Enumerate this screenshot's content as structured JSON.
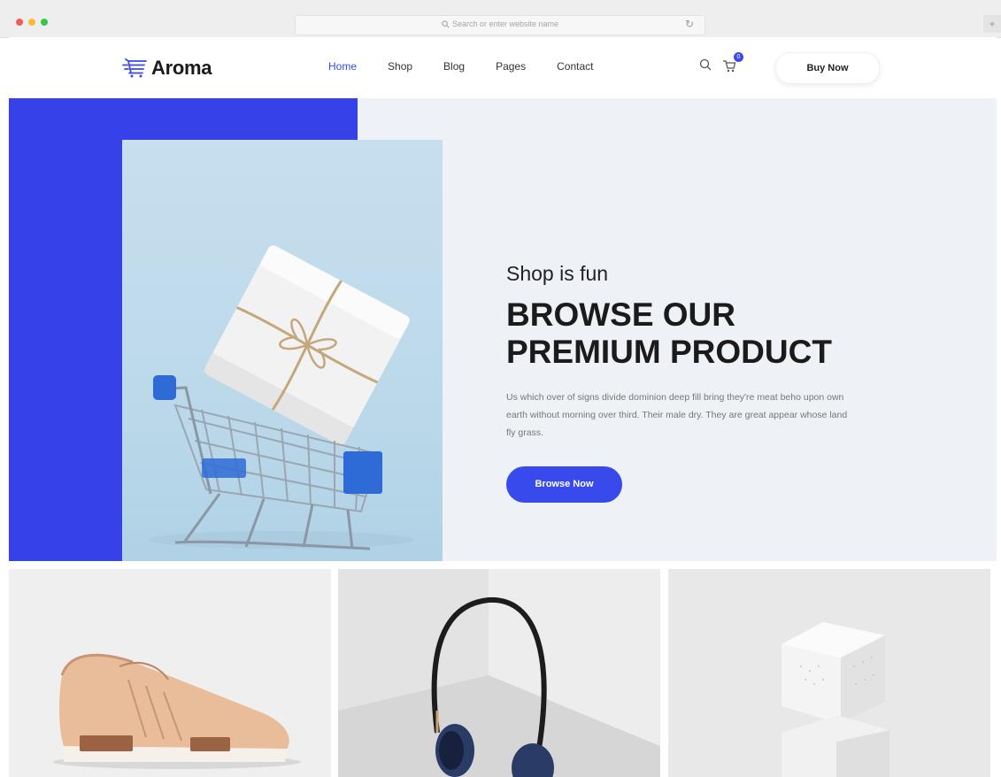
{
  "browser": {
    "address_placeholder": "Search or enter website name",
    "colors": {
      "close": "#f25e57",
      "minimize": "#f8bd2e",
      "maximize": "#33c649"
    },
    "icons": [
      "search-icon",
      "reload-icon",
      "new-tab-icon"
    ]
  },
  "header": {
    "logo_text": "Aroma",
    "logo_icon": "shopping-cart-icon",
    "nav": [
      {
        "label": "Home",
        "active": true
      },
      {
        "label": "Shop",
        "active": false
      },
      {
        "label": "Blog",
        "active": false
      },
      {
        "label": "Pages",
        "active": false
      },
      {
        "label": "Contact",
        "active": false
      }
    ],
    "cart_count": "0",
    "buy_now_label": "Buy Now",
    "icons": [
      "search-icon",
      "cart-icon"
    ]
  },
  "hero": {
    "subtitle": "Shop is fun",
    "title_line1": "BROWSE OUR",
    "title_line2": "PREMIUM PRODUCT",
    "description": "Us which over of signs divide dominion deep fill bring they're meat beho upon own earth without morning over third. Their male dry. They are great appear whose land fly grass.",
    "button_label": "Browse Now",
    "accent_color": "#384aeb",
    "image": "shopping-cart-with-gift-box"
  },
  "products": [
    {
      "image": "sneaker-image"
    },
    {
      "image": "headphones-image"
    },
    {
      "image": "white-cubes-image"
    }
  ]
}
